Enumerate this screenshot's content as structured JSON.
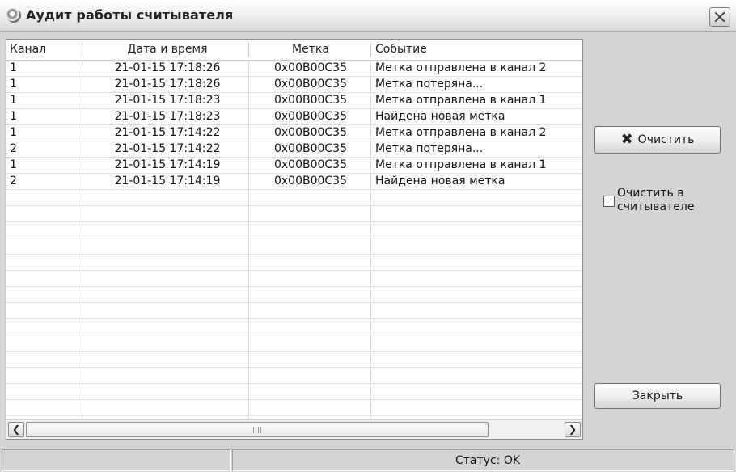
{
  "window": {
    "title": "Аудит работы считывателя"
  },
  "table": {
    "columns": [
      "Канал",
      "Дата и время",
      "Метка",
      "Событие"
    ],
    "rows": [
      {
        "channel": "1",
        "datetime": "21-01-15 17:18:26",
        "tag": "0x00B00C35",
        "event": "Метка отправлена в канал 2"
      },
      {
        "channel": "1",
        "datetime": "21-01-15 17:18:26",
        "tag": "0x00B00C35",
        "event": "Метка потеряна..."
      },
      {
        "channel": "1",
        "datetime": "21-01-15 17:18:23",
        "tag": "0x00B00C35",
        "event": "Метка отправлена в канал 1"
      },
      {
        "channel": "1",
        "datetime": "21-01-15 17:18:23",
        "tag": "0x00B00C35",
        "event": "Найдена новая метка"
      },
      {
        "channel": "1",
        "datetime": "21-01-15 17:14:22",
        "tag": "0x00B00C35",
        "event": "Метка отправлена в канал 2"
      },
      {
        "channel": "2",
        "datetime": "21-01-15 17:14:22",
        "tag": "0x00B00C35",
        "event": "Метка потеряна..."
      },
      {
        "channel": "1",
        "datetime": "21-01-15 17:14:19",
        "tag": "0x00B00C35",
        "event": "Метка отправлена в канал 1"
      },
      {
        "channel": "2",
        "datetime": "21-01-15 17:14:19",
        "tag": "0x00B00C35",
        "event": "Найдена новая метка"
      }
    ]
  },
  "buttons": {
    "clear": "Очистить",
    "close": "Закрыть"
  },
  "checkbox": {
    "label": "Очистить в считывателе",
    "checked": false
  },
  "status": {
    "text": "Статус: OK"
  },
  "icons": {
    "title": "reader-app-icon",
    "clear": "x-icon",
    "close": "close-icon",
    "scroll_left": "arrow-left-icon",
    "scroll_right": "arrow-right-icon"
  }
}
